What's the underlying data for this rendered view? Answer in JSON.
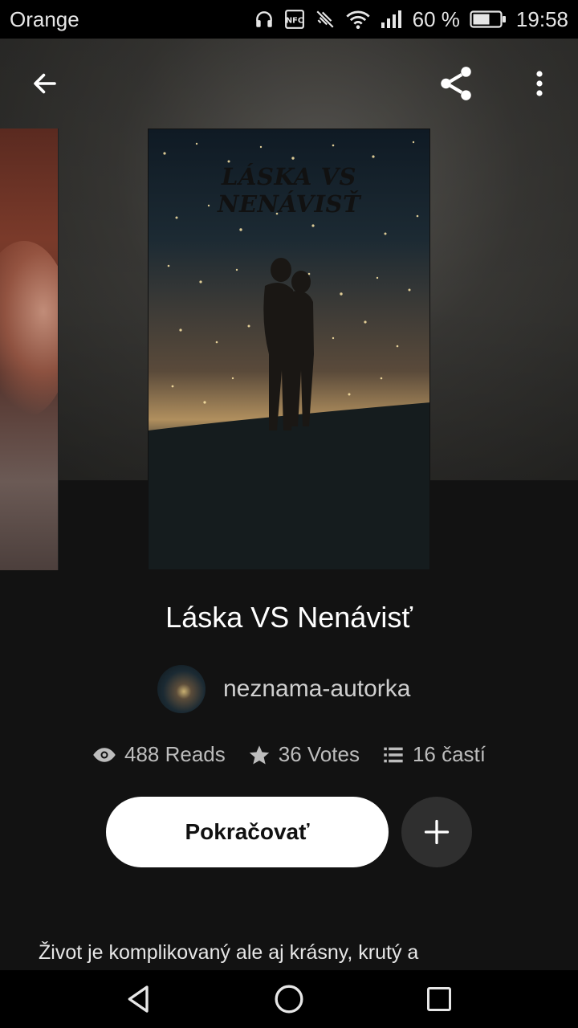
{
  "status_bar": {
    "carrier": "Orange",
    "battery": "60 %",
    "time": "19:58",
    "icons": [
      "headphones-icon",
      "nfc-icon",
      "vibrate-off-icon",
      "wifi-icon",
      "signal-icon",
      "battery-icon"
    ]
  },
  "toolbar": {
    "back_icon": "arrow-left-icon",
    "share_icon": "share-icon",
    "menu_icon": "more-vertical-icon"
  },
  "cover": {
    "title_text": "LÁSKA VS NENÁVISŤ"
  },
  "story": {
    "title": "Láska VS Nenávisť",
    "author": "neznama-autorka",
    "reads": "488 Reads",
    "votes": "36 Votes",
    "parts": "16 častí",
    "continue_label": "Pokračovať",
    "description": "Život je komplikovaný ale aj krásny, krutý a"
  },
  "colors": {
    "background": "#121212",
    "button_bg": "#ffffff",
    "add_button_bg": "#2f2f2f",
    "stat_text": "#bdbdbd"
  }
}
